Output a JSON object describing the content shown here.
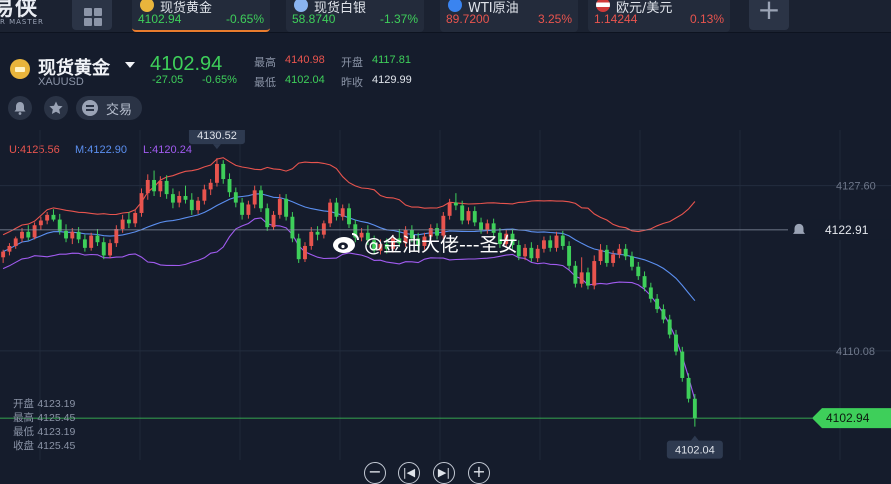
{
  "app": {
    "logo_text": "易侠",
    "logo_sub": "R MASTER"
  },
  "tickers": [
    {
      "name": "现货黄金",
      "price": "4102.94",
      "change": "-0.65%",
      "price_color": "#3ecf5a",
      "change_color": "#3ecf5a",
      "icon": "gold-icon",
      "icon_color": "#e9b53c",
      "active": true
    },
    {
      "name": "现货白银",
      "price": "58.8740",
      "change": "-1.37%",
      "price_color": "#3ecf5a",
      "change_color": "#3ecf5a",
      "icon": "silver-icon",
      "icon_color": "#8ab4f0",
      "active": false
    },
    {
      "name": "WTI原油",
      "price": "89.7200",
      "change": "3.25%",
      "price_color": "#e8544e",
      "change_color": "#e8544e",
      "icon": "oil-icon",
      "icon_color": "#3a84f0",
      "active": false
    },
    {
      "name": "欧元/美元",
      "price": "1.14244",
      "change": "0.13%",
      "price_color": "#e8544e",
      "change_color": "#e8544e",
      "icon": "us-flag-icon",
      "icon_color": "#d03a3a",
      "active": false
    }
  ],
  "header": {
    "symbol_name": "现货黄金",
    "symbol_code": "XAUUSD",
    "price": "4102.94",
    "change_abs": "-27.05",
    "change_pct": "-0.65%",
    "stats": {
      "high_label": "最高",
      "high": "4140.98",
      "open_label": "开盘",
      "open": "4117.81",
      "low_label": "最低",
      "low": "4102.04",
      "prev_close_label": "昨收",
      "prev_close": "4129.99"
    },
    "trade_label": "交易"
  },
  "indicator": {
    "upper_label": "U:4125.56",
    "middle_label": "M:4122.90",
    "lower_label": "L:4120.24",
    "upper_color": "#e8544e",
    "middle_color": "#5b8ff0",
    "lower_color": "#a15bf0"
  },
  "ohlc_panel": {
    "open_label": "开盘",
    "open": "4123.19",
    "high_label": "最高",
    "high": "4125.45",
    "low_label": "最低",
    "low": "4123.19",
    "close_label": "收盘",
    "close": "4125.45"
  },
  "watermark": "@金油大佬---圣女",
  "colors": {
    "up": "#e8544e",
    "down": "#3ecf5a",
    "background": "#151c2c"
  },
  "chart_data": {
    "type": "candlestick",
    "y_ticks": [
      4127.6,
      4110.08
    ],
    "y_tick_labels": [
      "4127.60",
      "4110.08"
    ],
    "ylim": [
      4098.5,
      4133.5
    ],
    "reference_price": 4122.91,
    "reference_label": "4122.91",
    "last_price": 4102.94,
    "last_label": "4102.94",
    "max_annotation": {
      "label": "4130.52",
      "value": 4130.52
    },
    "min_annotation": {
      "label": "4102.04",
      "value": 4102.04
    },
    "grid": true,
    "candles": [
      [
        4120.0,
        4120.8,
        4119.4,
        4120.6
      ],
      [
        4120.6,
        4121.5,
        4120.2,
        4121.2
      ],
      [
        4121.2,
        4122.2,
        4120.9,
        4122.0
      ],
      [
        4122.0,
        4123.1,
        4121.6,
        4122.7
      ],
      [
        4122.7,
        4123.4,
        4121.8,
        4122.1
      ],
      [
        4122.1,
        4123.7,
        4121.9,
        4123.4
      ],
      [
        4123.4,
        4124.3,
        4122.9,
        4123.9
      ],
      [
        4123.9,
        4124.8,
        4123.5,
        4124.5
      ],
      [
        4124.5,
        4125.1,
        4123.8,
        4124.0
      ],
      [
        4124.0,
        4124.6,
        4122.4,
        4122.8
      ],
      [
        4122.8,
        4123.5,
        4121.6,
        4122.0
      ],
      [
        4122.0,
        4123.1,
        4121.4,
        4122.7
      ],
      [
        4122.7,
        4123.2,
        4121.5,
        4121.9
      ],
      [
        4121.9,
        4122.4,
        4120.6,
        4121.0
      ],
      [
        4121.0,
        4122.6,
        4120.7,
        4122.3
      ],
      [
        4122.3,
        4123.0,
        4121.2,
        4121.6
      ],
      [
        4121.6,
        4122.1,
        4119.8,
        4120.2
      ],
      [
        4120.2,
        4121.9,
        4119.9,
        4121.5
      ],
      [
        4121.5,
        4123.4,
        4121.1,
        4123.0
      ],
      [
        4123.0,
        4124.5,
        4122.6,
        4124.0
      ],
      [
        4124.0,
        4124.8,
        4123.1,
        4123.6
      ],
      [
        4123.6,
        4125.0,
        4123.2,
        4124.7
      ],
      [
        4124.7,
        4127.3,
        4124.3,
        4126.8
      ],
      [
        4126.8,
        4128.8,
        4126.1,
        4128.2
      ],
      [
        4128.2,
        4129.2,
        4126.5,
        4127.0
      ],
      [
        4127.0,
        4128.6,
        4126.4,
        4128.1
      ],
      [
        4128.1,
        4128.7,
        4126.2,
        4126.7
      ],
      [
        4126.7,
        4127.3,
        4125.2,
        4125.8
      ],
      [
        4125.8,
        4127.0,
        4125.3,
        4126.5
      ],
      [
        4126.5,
        4127.6,
        4125.7,
        4126.1
      ],
      [
        4126.1,
        4126.8,
        4124.5,
        4125.0
      ],
      [
        4125.0,
        4126.4,
        4124.6,
        4126.0
      ],
      [
        4126.0,
        4127.7,
        4125.6,
        4127.2
      ],
      [
        4127.2,
        4128.3,
        4126.6,
        4127.9
      ],
      [
        4127.9,
        4130.52,
        4127.5,
        4129.9
      ],
      [
        4129.9,
        4130.3,
        4127.8,
        4128.3
      ],
      [
        4128.3,
        4128.9,
        4126.4,
        4126.9
      ],
      [
        4126.9,
        4127.4,
        4125.3,
        4125.8
      ],
      [
        4125.8,
        4126.3,
        4124.0,
        4124.5
      ],
      [
        4124.5,
        4126.0,
        4124.1,
        4125.6
      ],
      [
        4125.6,
        4127.6,
        4125.2,
        4127.1
      ],
      [
        4127.1,
        4127.6,
        4124.8,
        4125.2
      ],
      [
        4125.2,
        4125.7,
        4122.8,
        4123.2
      ],
      [
        4123.2,
        4124.9,
        4122.9,
        4124.5
      ],
      [
        4124.5,
        4126.7,
        4124.1,
        4126.2
      ],
      [
        4126.2,
        4126.7,
        4123.9,
        4124.3
      ],
      [
        4124.3,
        4124.8,
        4121.6,
        4122.0
      ],
      [
        4122.0,
        4122.5,
        4119.4,
        4119.8
      ],
      [
        4119.8,
        4121.6,
        4119.5,
        4121.2
      ],
      [
        4121.2,
        4123.2,
        4120.8,
        4122.7
      ],
      [
        4122.7,
        4123.3,
        4121.8,
        4122.4
      ],
      [
        4122.4,
        4123.9,
        4122.0,
        4123.6
      ],
      [
        4123.6,
        4126.2,
        4123.2,
        4125.8
      ],
      [
        4125.8,
        4126.3,
        4123.9,
        4124.3
      ],
      [
        4124.3,
        4125.6,
        4123.9,
        4125.2
      ],
      [
        4125.2,
        4125.7,
        4123.1,
        4123.5
      ],
      [
        4123.5,
        4124.0,
        4121.6,
        4122.1
      ],
      [
        4122.1,
        4123.1,
        4121.7,
        4122.6
      ],
      [
        4122.6,
        4123.4,
        4121.3,
        4121.8
      ],
      [
        4121.8,
        4122.3,
        4120.3,
        4120.7
      ],
      [
        4120.7,
        4121.9,
        4120.3,
        4121.4
      ],
      [
        4121.4,
        4122.0,
        4120.4,
        4120.9
      ],
      [
        4120.9,
        4122.4,
        4120.5,
        4122.0
      ],
      [
        4122.0,
        4123.0,
        4121.1,
        4121.5
      ],
      [
        4121.5,
        4123.3,
        4121.1,
        4122.9
      ],
      [
        4122.9,
        4123.4,
        4121.6,
        4122.0
      ],
      [
        4122.0,
        4122.6,
        4120.8,
        4121.2
      ],
      [
        4121.2,
        4122.6,
        4120.8,
        4122.2
      ],
      [
        4122.2,
        4123.5,
        4121.8,
        4123.1
      ],
      [
        4123.1,
        4123.6,
        4121.9,
        4122.3
      ],
      [
        4122.3,
        4124.8,
        4121.9,
        4124.4
      ],
      [
        4124.4,
        4126.2,
        4124.0,
        4125.8
      ],
      [
        4125.8,
        4126.8,
        4125.0,
        4125.5
      ],
      [
        4125.5,
        4126.0,
        4123.5,
        4123.9
      ],
      [
        4123.9,
        4125.3,
        4123.5,
        4124.9
      ],
      [
        4124.9,
        4125.4,
        4123.3,
        4123.7
      ],
      [
        4123.7,
        4124.2,
        4122.5,
        4122.9
      ],
      [
        4122.9,
        4124.0,
        4122.5,
        4123.6
      ],
      [
        4123.6,
        4124.1,
        4122.2,
        4122.6
      ],
      [
        4122.6,
        4123.1,
        4121.0,
        4121.4
      ],
      [
        4121.4,
        4122.9,
        4121.0,
        4122.5
      ],
      [
        4122.5,
        4123.0,
        4120.9,
        4121.3
      ],
      [
        4121.3,
        4121.8,
        4119.7,
        4120.1
      ],
      [
        4120.1,
        4121.4,
        4119.7,
        4121.0
      ],
      [
        4121.0,
        4121.6,
        4119.5,
        4119.9
      ],
      [
        4119.9,
        4121.3,
        4119.5,
        4120.9
      ],
      [
        4120.9,
        4122.2,
        4120.5,
        4121.8
      ],
      [
        4121.8,
        4122.3,
        4120.6,
        4121.0
      ],
      [
        4121.0,
        4122.7,
        4120.6,
        4122.3
      ],
      [
        4122.3,
        4122.8,
        4120.8,
        4121.2
      ],
      [
        4121.2,
        4121.7,
        4118.7,
        4119.1
      ],
      [
        4119.1,
        4119.6,
        4116.8,
        4117.2
      ],
      [
        4117.2,
        4120.0,
        4116.8,
        4118.4
      ],
      [
        4118.4,
        4118.9,
        4116.6,
        4117.0
      ],
      [
        4117.0,
        4120.2,
        4116.6,
        4119.6
      ],
      [
        4119.6,
        4121.4,
        4119.2,
        4120.8
      ],
      [
        4120.8,
        4121.3,
        4119.0,
        4119.4
      ],
      [
        4119.4,
        4120.7,
        4119.0,
        4120.3
      ],
      [
        4120.3,
        4121.4,
        4119.9,
        4120.9
      ],
      [
        4120.9,
        4121.4,
        4119.7,
        4120.1
      ],
      [
        4120.1,
        4120.6,
        4118.6,
        4119.0
      ],
      [
        4119.0,
        4119.5,
        4117.6,
        4118.0
      ],
      [
        4118.0,
        4118.5,
        4116.4,
        4116.8
      ],
      [
        4116.8,
        4117.3,
        4115.2,
        4115.6
      ],
      [
        4115.6,
        4116.1,
        4114.1,
        4114.5
      ],
      [
        4114.5,
        4115.0,
        4113.0,
        4113.4
      ],
      [
        4113.4,
        4113.9,
        4111.4,
        4111.8
      ],
      [
        4111.8,
        4112.3,
        4109.6,
        4110.0
      ],
      [
        4110.0,
        4110.5,
        4106.8,
        4107.2
      ],
      [
        4107.2,
        4107.7,
        4104.6,
        4105.0
      ],
      [
        4105.0,
        4105.5,
        4102.04,
        4102.94
      ]
    ]
  }
}
